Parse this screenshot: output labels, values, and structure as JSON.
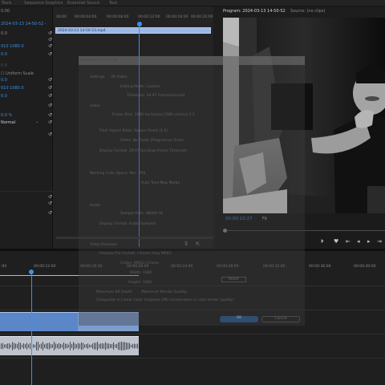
{
  "top_tabs": [
    "Tools",
    "Sequence Graphics",
    "Essential Sound",
    "Text"
  ],
  "effect_controls": {
    "rows": [
      {
        "text": "0.00",
        "blue": false
      },
      {
        "text": "2024-03-13 14-50-52 - ",
        "blue": true
      },
      {
        "text": "0.0",
        "blue": false
      },
      {
        "text": "0.0",
        "blue": false
      },
      {
        "text": "010   1080.0",
        "blue": true
      },
      {
        "text": "0.0",
        "blue": true
      },
      {
        "text": "0.0",
        "blue": false
      },
      {
        "text": "Uniform Scale",
        "blue": false
      },
      {
        "text": "0.0",
        "blue": true
      },
      {
        "text": "0.0",
        "blue": false
      },
      {
        "text": "010   1080.0",
        "blue": true
      },
      {
        "text": "0.0",
        "blue": true
      },
      {
        "text": "0.0",
        "blue": false
      },
      {
        "text": "0.0 %",
        "blue": true
      },
      {
        "text": "Normal",
        "blue": false
      },
      {
        "text": "",
        "blue": false
      }
    ]
  },
  "mini_timeline": {
    "ruler": [
      "00:00",
      "00:00:04:00",
      "00:00:08:00",
      "00:00:12:00",
      "00:00:16:00",
      "00:00:20:00"
    ],
    "clip_name": "2024-03-13 14-50-53.mp4"
  },
  "program_monitor": {
    "title": "Program: 2024-03-13 14-50-52",
    "source_label": "Source: (no clips)",
    "timecode": "00:00:10:27",
    "fit": "Fit",
    "controls": [
      "⏵",
      "♥",
      "⇤",
      "◂",
      "▸",
      "⇥"
    ]
  },
  "dialog": {
    "title": "Sequence Settings",
    "tabs": [
      "Settings",
      "VR Video"
    ],
    "texts": [
      "Editing Mode:   Custom",
      "Timebase:   29.97 frames/second",
      "Video",
      "Frame Size:   1080   horizontal   1080   vertical   1:1",
      "Pixel Aspect Ratio:   Square Pixels (1.0)",
      "Fields:   No Fields (Progressive Scan)",
      "Display Format:   29.97 fps Drop-Frame Timecode",
      "Working Color Space:   Rec. 709",
      "Auto Tone Map Media",
      "Audio",
      "Sample Rate:   48000 Hz",
      "Display Format:   Audio Samples",
      "Video Previews",
      "Preview File Format:   I-Frame Only MPEG",
      "Codec:   MPEG I-Frame",
      "Width:   1080",
      "Height:   1080",
      "Reset",
      "Maximum Bit Depth",
      "Maximum Render Quality",
      "Composite in Linear Color (requires GPU acceleration or max render quality)",
      "OK",
      "Cancel"
    ]
  },
  "timeline": {
    "ruler": [
      ":00",
      "00:00:12:00",
      "00:00:16:00",
      "00:00:20:00",
      "00:00:24:00",
      "00:00:28:00",
      "00:00:32:00",
      "00:00:36:00",
      "00:00:40:00"
    ]
  },
  "colors": {
    "accent": "#3f8ff0",
    "video_clip": "#5b87c9",
    "audio_clip": "#bfc4cc",
    "workarea": "#d4c63a"
  }
}
